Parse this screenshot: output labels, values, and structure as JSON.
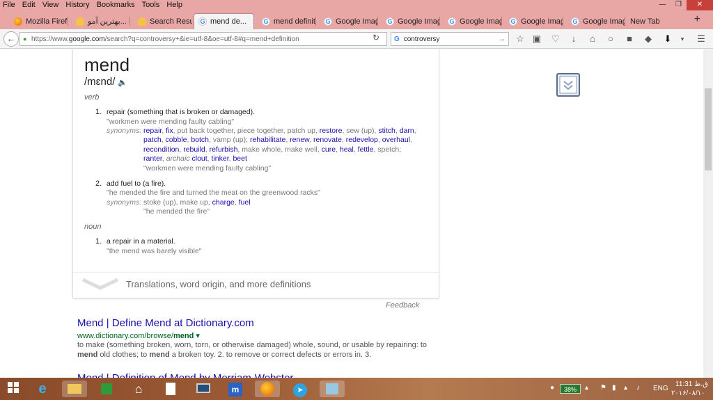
{
  "menubar": {
    "items": [
      "File",
      "Edit",
      "View",
      "History",
      "Bookmarks",
      "Tools",
      "Help"
    ]
  },
  "tabs": [
    {
      "label": "Mozilla Firef...",
      "icon": "firefox-icon"
    },
    {
      "label": "بهترین آمو...",
      "icon": "sun-icon"
    },
    {
      "label": "Search Resul...",
      "icon": "sun-icon"
    },
    {
      "label": "mend de...",
      "icon": "google-icon",
      "active": true
    },
    {
      "label": "mend definit...",
      "icon": "google-icon"
    },
    {
      "label": "Google Imag...",
      "icon": "google-icon"
    },
    {
      "label": "Google Imag...",
      "icon": "google-icon"
    },
    {
      "label": "Google Imag...",
      "icon": "google-icon"
    },
    {
      "label": "Google Imag...",
      "icon": "google-icon"
    },
    {
      "label": "Google Imag...",
      "icon": "google-icon"
    },
    {
      "label": "New Tab",
      "icon": ""
    }
  ],
  "navbar": {
    "url_prefix": "https://www.",
    "url_domain": "google.com",
    "url_rest": "/search?q=controversy+&ie=utf-8&oe=utf-8#q=mend+definition",
    "search_value": "controversy"
  },
  "definition": {
    "word": "mend",
    "phonetic": "/mɛnd/",
    "verb_label": "verb",
    "noun_label": "noun",
    "sense1": {
      "num": "1.",
      "def": "repair (something that is broken or damaged).",
      "example": "\"workmen were mending faulty cabling\"",
      "syn_label": "synonyms:",
      "l1": [
        {
          "t": "repair",
          "link": true
        },
        {
          "t": ", ",
          "link": false
        },
        {
          "t": "fix",
          "link": true
        },
        {
          "t": ", put back together, piece together, patch up, ",
          "link": false
        },
        {
          "t": "restore",
          "link": true
        },
        {
          "t": ", sew (up), ",
          "link": false
        },
        {
          "t": "stitch",
          "link": true
        },
        {
          "t": ", ",
          "link": false
        },
        {
          "t": "darn",
          "link": true
        },
        {
          "t": ",",
          "link": false
        }
      ],
      "l2": [
        {
          "t": "patch",
          "link": true
        },
        {
          "t": ", ",
          "link": false
        },
        {
          "t": "cobble",
          "link": true
        },
        {
          "t": ", ",
          "link": false
        },
        {
          "t": "botch",
          "link": true
        },
        {
          "t": ", vamp (up); ",
          "link": false
        },
        {
          "t": "rehabilitate",
          "link": true
        },
        {
          "t": ", ",
          "link": false
        },
        {
          "t": "renew",
          "link": true
        },
        {
          "t": ", ",
          "link": false
        },
        {
          "t": "renovate",
          "link": true
        },
        {
          "t": ", ",
          "link": false
        },
        {
          "t": "redevelop",
          "link": true
        },
        {
          "t": ", ",
          "link": false
        },
        {
          "t": "overhaul",
          "link": true
        },
        {
          "t": ",",
          "link": false
        }
      ],
      "l3": [
        {
          "t": "recondition",
          "link": true
        },
        {
          "t": ", ",
          "link": false
        },
        {
          "t": "rebuild",
          "link": true
        },
        {
          "t": ", ",
          "link": false
        },
        {
          "t": "refurbish",
          "link": true
        },
        {
          "t": ", make whole, make well, ",
          "link": false
        },
        {
          "t": "cure",
          "link": true
        },
        {
          "t": ", ",
          "link": false
        },
        {
          "t": "heal",
          "link": true
        },
        {
          "t": ", ",
          "link": false
        },
        {
          "t": "fettle",
          "link": true
        },
        {
          "t": ", spetch;",
          "link": false
        }
      ],
      "l4": [
        {
          "t": "ranter",
          "link": true
        },
        {
          "t": ", ",
          "link": false
        },
        {
          "t": "archaic",
          "link": false,
          "italic": true
        },
        {
          "t": " ",
          "link": false
        },
        {
          "t": "clout",
          "link": true
        },
        {
          "t": ", ",
          "link": false
        },
        {
          "t": "tinker",
          "link": true
        },
        {
          "t": ", ",
          "link": false
        },
        {
          "t": "beet",
          "link": true
        }
      ],
      "syn_example": "\"workmen were mending faulty cabling\""
    },
    "sense2": {
      "num": "2.",
      "def": "add fuel to (a fire).",
      "example": "\"he mended the fire and turned the meat on the greenwood racks\"",
      "syn_label": "synonyms:",
      "l1": [
        {
          "t": "stoke (up), make up, ",
          "link": false
        },
        {
          "t": "charge",
          "link": true
        },
        {
          "t": ", ",
          "link": false
        },
        {
          "t": "fuel",
          "link": true
        }
      ],
      "syn_example": "\"he mended the fire\""
    },
    "sense3": {
      "num": "1.",
      "def": "a repair in a material.",
      "example": "\"the mend was barely visible\""
    },
    "more_text": "Translations, word origin, and more definitions",
    "feedback": "Feedback"
  },
  "results": [
    {
      "title": "Mend | Define Mend at Dictionary.com",
      "url_prefix": "www.dictionary.com/browse/",
      "url_bold": "mend",
      "snippet1": "to make (something broken, worn, torn, or otherwise damaged) whole, sound, or usable by repairing: to",
      "snippet2_bold1": "mend",
      "snippet2_mid": " old clothes; to ",
      "snippet2_bold2": "mend",
      "snippet2_end": " a broken toy. 2. to remove or correct defects or errors in. 3."
    },
    {
      "title": "Mend | Definition of Mend by Merriam-Webster"
    }
  ],
  "taskbar": {
    "battery": "38%",
    "lang": "ENG",
    "time": "11:31 ق.ظ",
    "date": "۲۰۱۶/۰۸/۱۰"
  },
  "colors": {
    "chrome": "#e8a7a5",
    "link": "#1a0dab",
    "url_green": "#006621"
  }
}
